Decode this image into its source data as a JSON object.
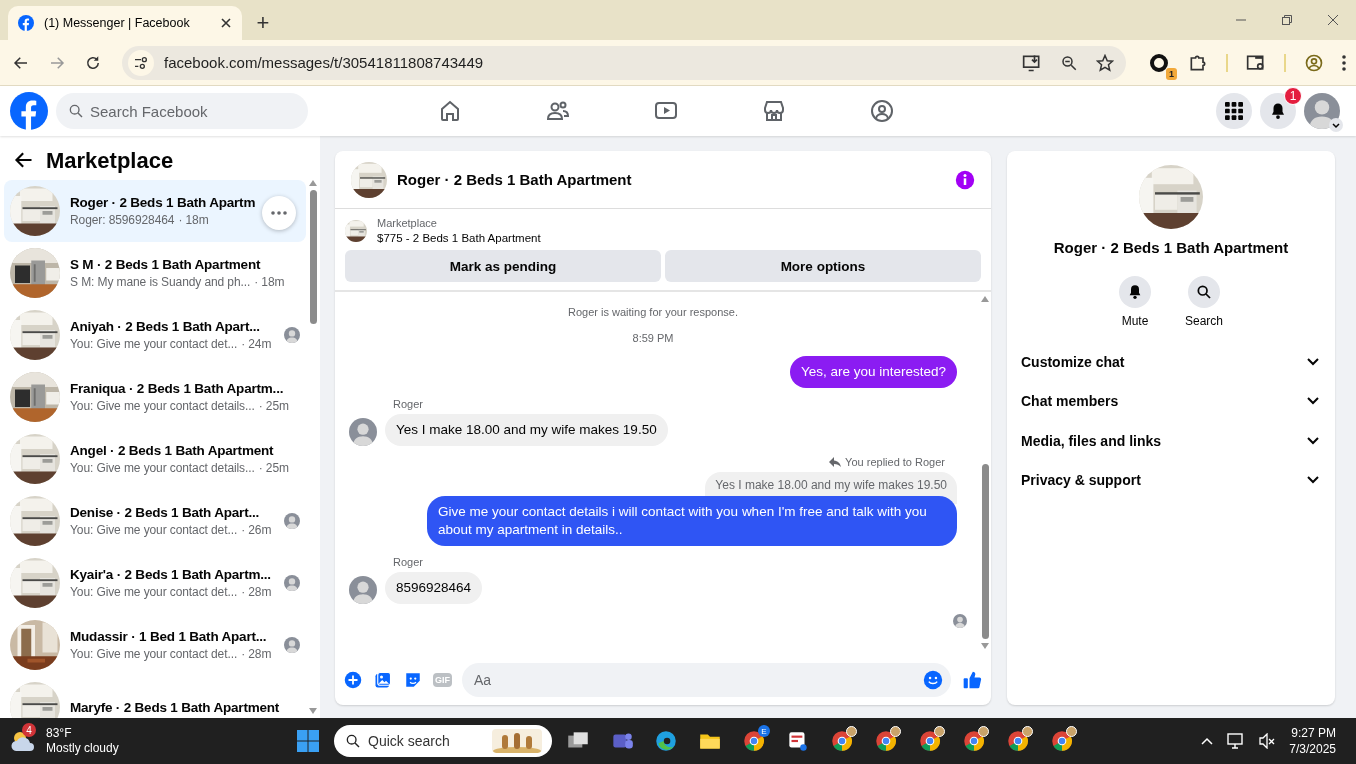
{
  "browser": {
    "tab": {
      "title": "(1) Messenger | Facebook",
      "selected": true
    },
    "new_tab": "+",
    "url": "facebook.com/messages/t/30541811808743449",
    "extension_badge": "1"
  },
  "header": {
    "search": {
      "placeholder": "Search Facebook"
    },
    "notification_badge": "1"
  },
  "sidebar": {
    "title": "Marketplace",
    "conversations": [
      {
        "name": "Roger · 2 Beds 1 Bath Apartm",
        "preview": "Roger: 8596928464",
        "time": "· 18m",
        "selected": true,
        "seen": false
      },
      {
        "name": "S M · 2 Beds 1 Bath Apartment",
        "preview": "S M: My mane is Suandy and ph...",
        "time": "· 18m",
        "selected": false,
        "seen": false
      },
      {
        "name": "Aniyah · 2 Beds 1 Bath Apart...",
        "preview": "You: Give me your contact det...",
        "time": "· 24m",
        "selected": false,
        "seen": true
      },
      {
        "name": "Franiqua · 2 Beds 1 Bath Apartm...",
        "preview": "You: Give me your contact details...",
        "time": "· 25m",
        "selected": false,
        "seen": false
      },
      {
        "name": "Angel · 2 Beds 1 Bath Apartment",
        "preview": "You: Give me your contact details...",
        "time": "· 25m",
        "selected": false,
        "seen": false
      },
      {
        "name": "Denise · 2 Beds 1 Bath Apart...",
        "preview": "You: Give me your contact det...",
        "time": "· 26m",
        "selected": false,
        "seen": true
      },
      {
        "name": "Kyair'a · 2 Beds 1 Bath Apartm...",
        "preview": "You: Give me your contact det...",
        "time": "· 28m",
        "selected": false,
        "seen": true
      },
      {
        "name": "Mudassir · 1 Bed 1 Bath Apart...",
        "preview": "You: Give me your contact det...",
        "time": "· 28m",
        "selected": false,
        "seen": true
      },
      {
        "name": "Maryfe · 2 Beds 1 Bath Apartment",
        "selected": false,
        "seen": false
      }
    ]
  },
  "chat": {
    "title": "Roger · 2 Beds 1 Bath Apartment",
    "listing": {
      "label": "Marketplace",
      "title": "$775 - 2 Beds 1 Bath Apartment"
    },
    "actions": [
      "Mark as pending",
      "More options"
    ],
    "messages": [
      {
        "kind": "notice",
        "text": "Roger is waiting for your response."
      },
      {
        "kind": "time",
        "text": "8:59 PM"
      },
      {
        "kind": "sent",
        "text": "Yes, are you interested?",
        "color": "#8b1cf2"
      },
      {
        "kind": "received",
        "sender": "Roger",
        "text": "Yes I make 18.00 and my wife makes 19.50"
      },
      {
        "kind": "sent",
        "reply_label": "You replied to Roger",
        "quote": "Yes I make 18.00 and my wife makes 19.50",
        "text": "Give me your contact details i will contact with you when I'm free and talk with you about my apartment in details..",
        "color": "#2f55f4"
      },
      {
        "kind": "received",
        "sender": "Roger",
        "text": "8596928464"
      }
    ],
    "composer": {
      "gif_label": "GIF",
      "placeholder": "Aa"
    }
  },
  "details": {
    "title": "Roger · 2 Beds 1 Bath Apartment",
    "actions": [
      {
        "kind": "mute",
        "label": "Mute"
      },
      {
        "kind": "search",
        "label": "Search"
      }
    ],
    "sections": [
      {
        "label": "Customize chat",
        "expanded": false
      },
      {
        "label": "Chat members",
        "expanded": false
      },
      {
        "label": "Media, files and links",
        "expanded": false
      },
      {
        "label": "Privacy & support",
        "expanded": false
      }
    ]
  },
  "taskbar": {
    "weather": {
      "badge": "4",
      "temperature": "83°F",
      "condition": "Mostly cloudy"
    },
    "search": {
      "placeholder": "Quick search"
    },
    "apps": [
      {
        "kind": "taskview"
      },
      {
        "kind": "teams"
      },
      {
        "kind": "edge"
      },
      {
        "kind": "folder"
      },
      {
        "kind": "chrome",
        "badge": "E"
      },
      {
        "kind": "snip"
      },
      {
        "kind": "chrome_profile"
      },
      {
        "kind": "chrome_profile"
      },
      {
        "kind": "chrome_profile"
      },
      {
        "kind": "chrome_profile"
      },
      {
        "kind": "chrome_profile"
      },
      {
        "kind": "chrome_profile"
      }
    ],
    "time": "9:27 PM",
    "date": "7/3/2025"
  }
}
